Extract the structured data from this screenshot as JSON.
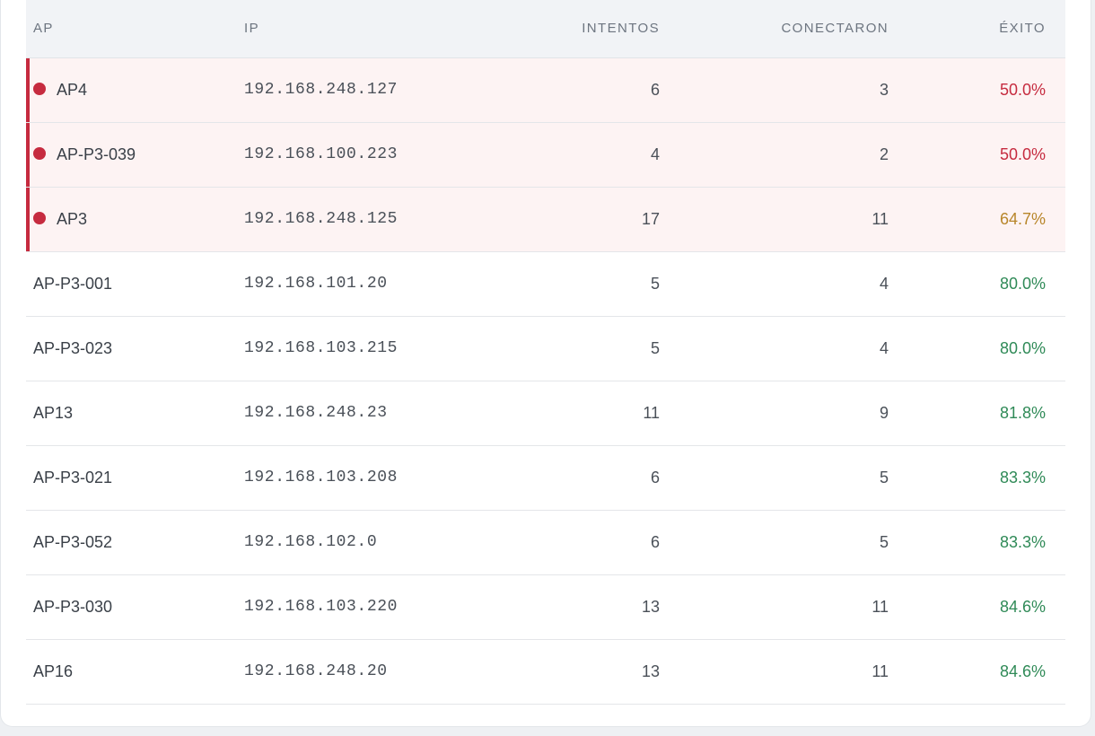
{
  "table": {
    "columns": {
      "ap": "AP",
      "ip": "IP",
      "attempts": "INTENTOS",
      "connected": "CONECTARON",
      "success": "ÉXITO"
    },
    "colors": {
      "alert_bar": "#c62b3f",
      "alert_row_bg": "#fdf3f3",
      "red": "#c62b3f",
      "amber": "#b8862a",
      "green": "#2f8a57"
    },
    "rows": [
      {
        "ap": "AP4",
        "ip": "192.168.248.127",
        "attempts": "6",
        "connected": "3",
        "success": "50.0%",
        "alert": true,
        "status_color": "#c62b3f",
        "indicator_icon": "red-dot-icon"
      },
      {
        "ap": "AP-P3-039",
        "ip": "192.168.100.223",
        "attempts": "4",
        "connected": "2",
        "success": "50.0%",
        "alert": true,
        "status_color": "#c62b3f",
        "indicator_icon": "red-dot-icon"
      },
      {
        "ap": "AP3",
        "ip": "192.168.248.125",
        "attempts": "17",
        "connected": "11",
        "success": "64.7%",
        "alert": true,
        "status_color": "#b8862a",
        "indicator_icon": "red-dot-icon"
      },
      {
        "ap": "AP-P3-001",
        "ip": "192.168.101.20",
        "attempts": "5",
        "connected": "4",
        "success": "80.0%",
        "alert": false,
        "status_color": "#2f8a57"
      },
      {
        "ap": "AP-P3-023",
        "ip": "192.168.103.215",
        "attempts": "5",
        "connected": "4",
        "success": "80.0%",
        "alert": false,
        "status_color": "#2f8a57"
      },
      {
        "ap": "AP13",
        "ip": "192.168.248.23",
        "attempts": "11",
        "connected": "9",
        "success": "81.8%",
        "alert": false,
        "status_color": "#2f8a57"
      },
      {
        "ap": "AP-P3-021",
        "ip": "192.168.103.208",
        "attempts": "6",
        "connected": "5",
        "success": "83.3%",
        "alert": false,
        "status_color": "#2f8a57"
      },
      {
        "ap": "AP-P3-052",
        "ip": "192.168.102.0",
        "attempts": "6",
        "connected": "5",
        "success": "83.3%",
        "alert": false,
        "status_color": "#2f8a57"
      },
      {
        "ap": "AP-P3-030",
        "ip": "192.168.103.220",
        "attempts": "13",
        "connected": "11",
        "success": "84.6%",
        "alert": false,
        "status_color": "#2f8a57"
      },
      {
        "ap": "AP16",
        "ip": "192.168.248.20",
        "attempts": "13",
        "connected": "11",
        "success": "84.6%",
        "alert": false,
        "status_color": "#2f8a57"
      }
    ]
  }
}
